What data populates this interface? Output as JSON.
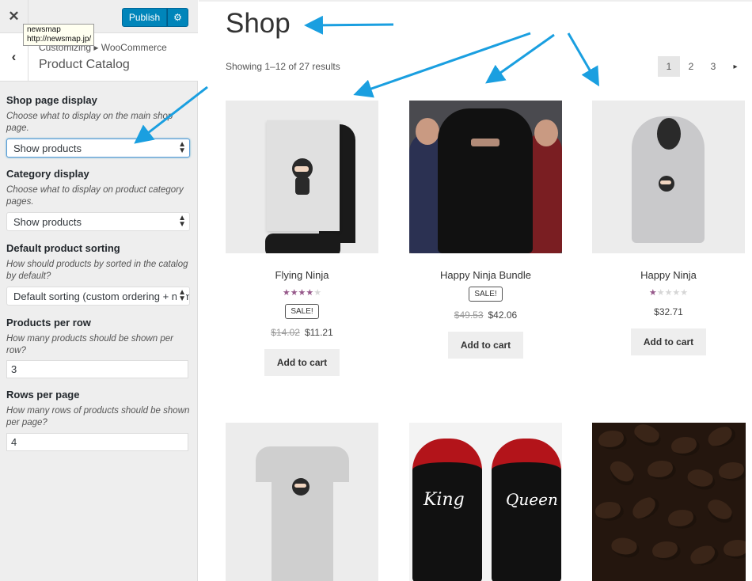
{
  "customizer": {
    "close_icon": "close-icon",
    "publish_label": "Publish",
    "settings_icon": "gear-icon",
    "tooltip": {
      "line1": "newsmap",
      "line2": "http://newsmap.jp/"
    },
    "breadcrumb": "Customizing ▸ WooCommerce",
    "section_title": "Product Catalog",
    "controls": {
      "shop_page_display": {
        "title": "Shop page display",
        "desc": "Choose what to display on the main shop page.",
        "value": "Show products"
      },
      "category_display": {
        "title": "Category display",
        "desc": "Choose what to display on product category pages.",
        "value": "Show products"
      },
      "default_sorting": {
        "title": "Default product sorting",
        "desc": "How should products by sorted in the catalog by default?",
        "value": "Default sorting (custom ordering + name)"
      },
      "products_per_row": {
        "title": "Products per row",
        "desc": "How many products should be shown per row?",
        "value": "3"
      },
      "rows_per_page": {
        "title": "Rows per page",
        "desc": "How many rows of products should be shown per page?",
        "value": "4"
      }
    }
  },
  "shop": {
    "title": "Shop",
    "result_count": "Showing 1–12 of 27 results",
    "pages": [
      "1",
      "2",
      "3"
    ],
    "next_icon": "▸",
    "products": [
      {
        "name": "Flying Ninja",
        "rating": 4,
        "sale": "SALE!",
        "old_price": "$14.02",
        "price": "$11.21",
        "button": "Add to cart"
      },
      {
        "name": "Happy Ninja Bundle",
        "rating": 0,
        "sale": "SALE!",
        "old_price": "$49.53",
        "price": "$42.06",
        "button": "Add to cart"
      },
      {
        "name": "Happy Ninja",
        "rating": 1,
        "sale": "",
        "old_price": "",
        "price": "$32.71",
        "button": "Add to cart"
      }
    ]
  },
  "colors": {
    "accent": "#0085ba",
    "star": "#96588a",
    "arrow": "#1a9fe0"
  }
}
